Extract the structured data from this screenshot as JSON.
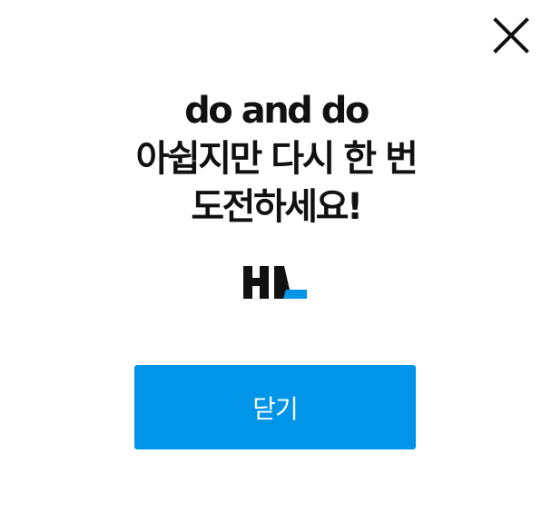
{
  "dialog": {
    "close_icon": "close-icon",
    "headline": {
      "line1": "do and do",
      "line2": "아쉽지만 다시 한 번",
      "line3": "도전하세요!"
    },
    "logo_icon": "hl-logo",
    "confirm_label": "닫기"
  },
  "colors": {
    "accent": "#0095e9",
    "text": "#111111",
    "background": "#ffffff",
    "logo_dark": "#111111",
    "logo_accent": "#0095e9"
  }
}
